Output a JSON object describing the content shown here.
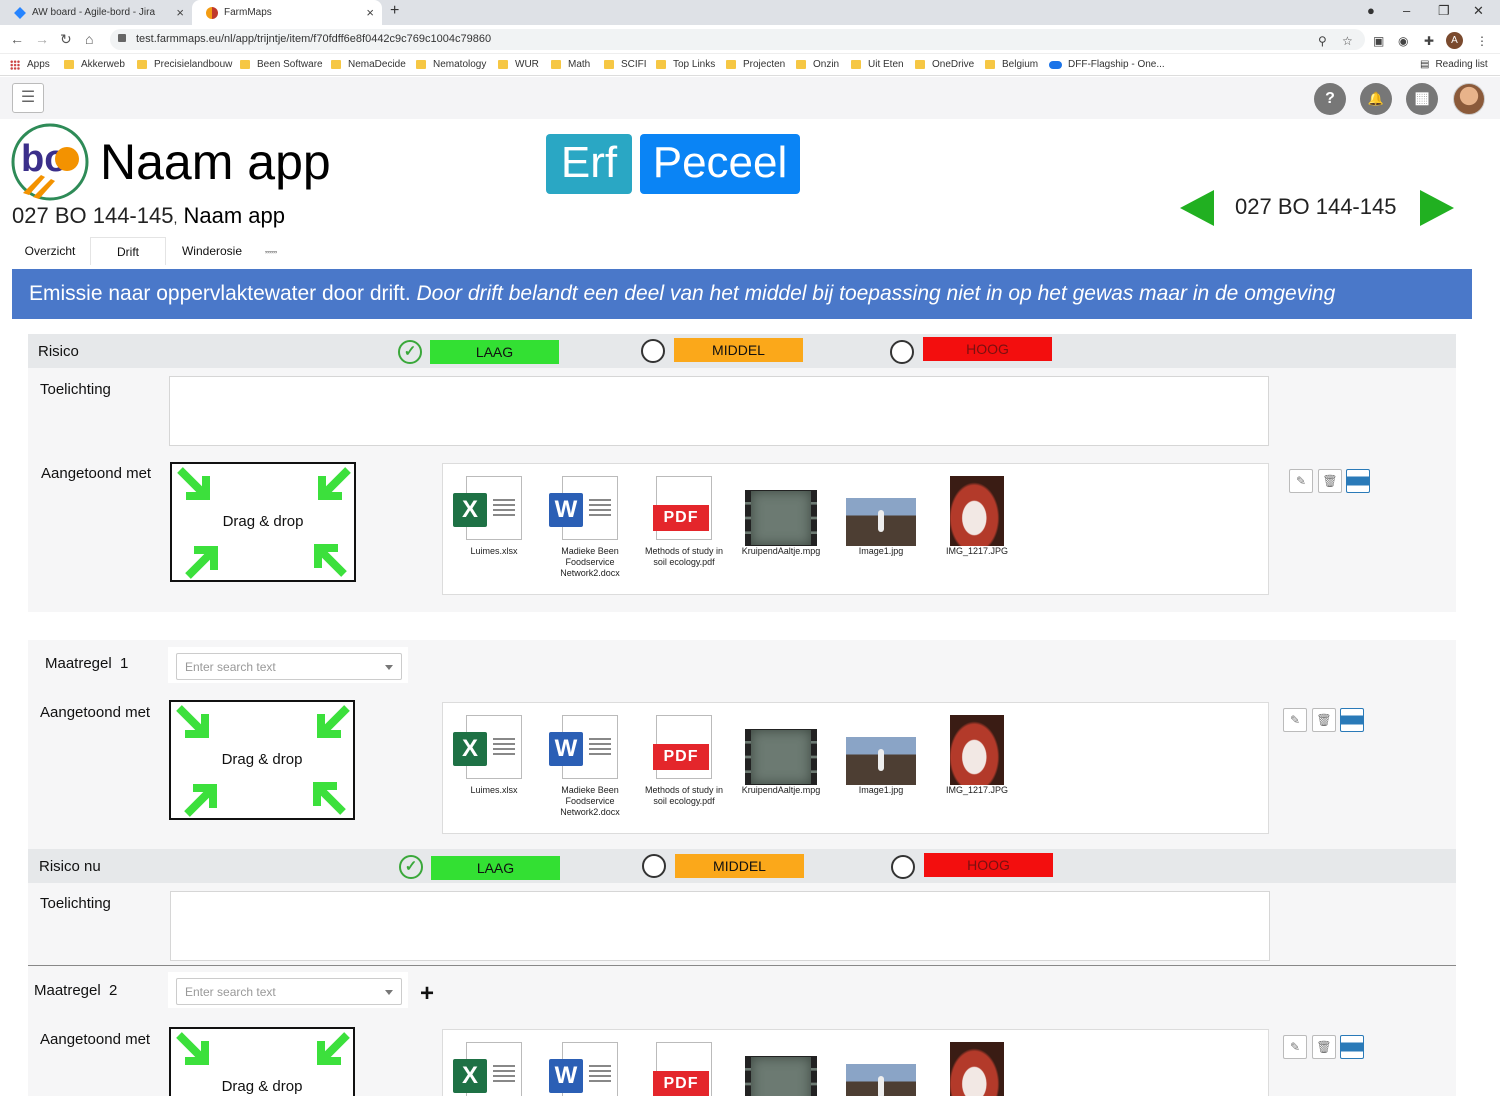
{
  "browser": {
    "tabs": [
      {
        "title": "AW board - Agile-bord - Jira",
        "active": false
      },
      {
        "title": "FarmMaps",
        "active": true
      }
    ],
    "new_tab": "+",
    "tab_close": "×",
    "url": "test.farmmaps.eu/nl/app/trijntje/item/f70fdff6e8f0442c9c769c1004c79860",
    "profile_initial": "A",
    "bookmarks": [
      "Apps",
      "Akkerweb",
      "Precisielandbouw",
      "Been Software",
      "NemaDecide",
      "Nematology",
      "WUR",
      "Math",
      "SCIFI",
      "Top Links",
      "Projecten",
      "Onzin",
      "Uit Eten",
      "OneDrive",
      "Belgium",
      "DFF-Flagship - One..."
    ],
    "reading_list": "Reading list"
  },
  "toolbar": {
    "menu_icon": "☰",
    "help_icon": "?",
    "bell_icon": "🔔",
    "grid_icon": "▦"
  },
  "header": {
    "logo_letters": "bo",
    "app_name": "Naam app",
    "parcel_code": "027 BO 144-145",
    "separator": ",",
    "subtitle_app": "Naam app",
    "btn_erf": "Erf",
    "btn_perceel": "Peceel",
    "nav_parcel": "027 BO 144-145"
  },
  "tabs": [
    {
      "label": "Overzicht",
      "active": false
    },
    {
      "label": "Drift",
      "active": true
    },
    {
      "label": "Winderosie",
      "active": false
    },
    {
      "label": "‚‚‚‚‚‚",
      "active": false
    }
  ],
  "banner": {
    "lead": "Emissie naar oppervlaktewater door drift.",
    "italic": "Door drift belandt een deel van het middel bij toepassing niet in op het gewas maar in de omgeving"
  },
  "risk_levels": {
    "low": "LAAG",
    "medium": "MIDDEL",
    "high": "HOOG"
  },
  "colors": {
    "low": "#33e033",
    "medium": "#fba81a",
    "high": "#f30e0e",
    "banner": "#4a78c9",
    "erf": "#2aa7c4",
    "perceel": "#0a84f5",
    "nav_arrow": "#21b021"
  },
  "labels": {
    "risico": "Risico",
    "risico_nu": "Risico nu",
    "toelichting": "Toelichting",
    "aangetoond_met": "Aangetoond met",
    "maatregel": "Maatregel",
    "drag_drop": "Drag & drop",
    "search_placeholder": "Enter search text",
    "add": "+"
  },
  "risk_selection": {
    "risico": "LAAG",
    "risico_nu": "LAAG"
  },
  "measures": [
    {
      "label": "Maatregel",
      "number": "1"
    },
    {
      "label": "Maatregel",
      "number": "2"
    }
  ],
  "files": [
    {
      "name": "Luimes.xlsx",
      "type": "excel-icon",
      "badge": "X",
      "color": "#1e7145"
    },
    {
      "name": "Madieke Been Foodservice Network2.docx",
      "type": "word-icon",
      "badge": "W",
      "color": "#2b5fb5"
    },
    {
      "name": "Methods of study in soil ecology.pdf",
      "type": "pdf-icon",
      "badge": "PDF",
      "color": "#e4262b"
    },
    {
      "name": "KruipendAaltje.mpg",
      "type": "video-icon",
      "badge": "",
      "color": "#6c7a72"
    },
    {
      "name": "Image1.jpg",
      "type": "image-icon",
      "badge": "",
      "color": "#4d3e33"
    },
    {
      "name": "IMG_1217.JPG",
      "type": "image-icon",
      "badge": "",
      "color": "#b33a2a"
    }
  ],
  "file_actions": {
    "edit": "✎",
    "delete": "🗑",
    "image": ""
  }
}
